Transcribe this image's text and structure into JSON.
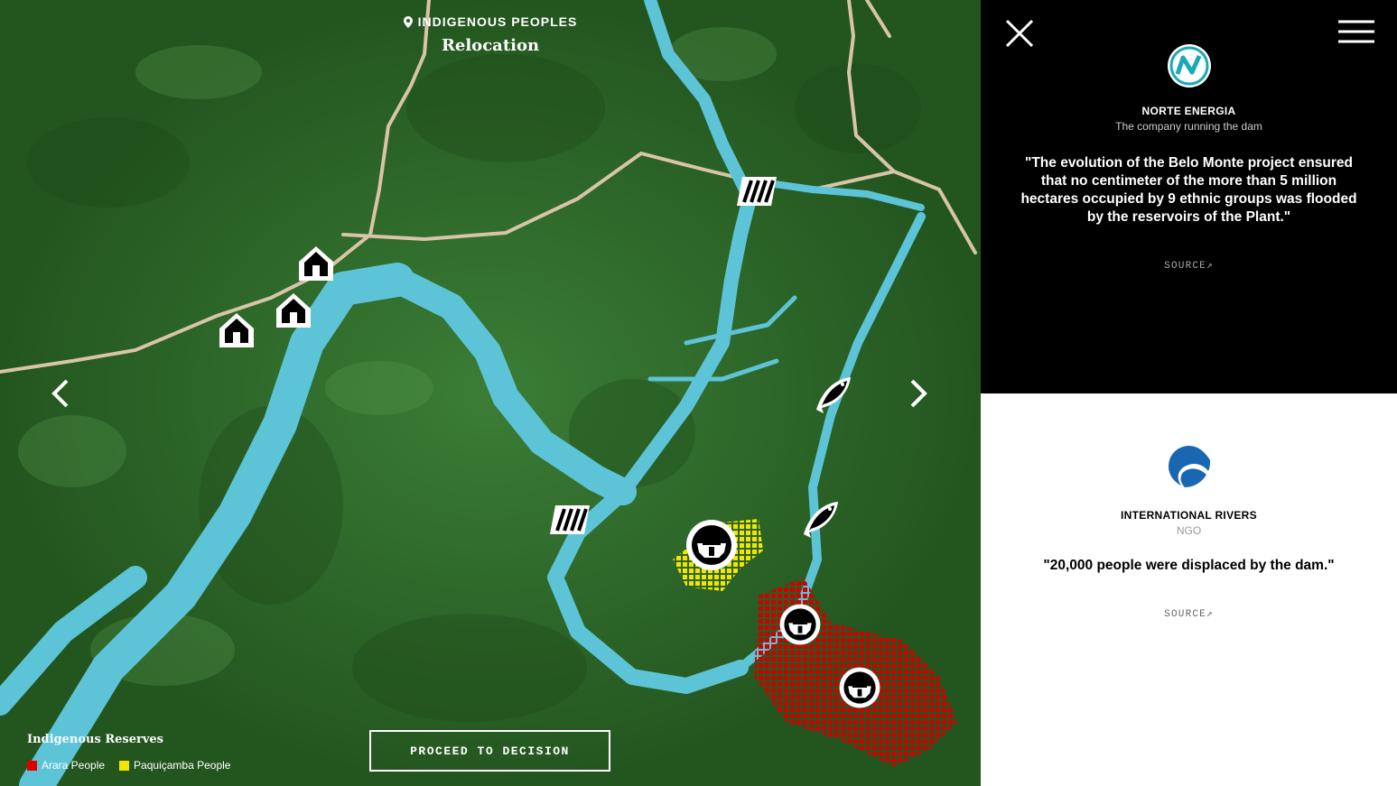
{
  "map": {
    "kicker": "INDIGENOUS PEOPLES",
    "title": "Relocation",
    "legend": {
      "title": "Indigenous Reserves",
      "items": [
        {
          "label": "Arara People",
          "color": "#e00000"
        },
        {
          "label": "Paquiçamba People",
          "color": "#f2e600"
        }
      ]
    },
    "proceed_label": "PROCEED TO DECISION",
    "colors": {
      "forest": "#2d6a2a",
      "river": "#5cc4d6",
      "road": "#d9c4a8"
    }
  },
  "panels": {
    "top": {
      "org_name": "NORTE ENERGIA",
      "org_role": "The company running the dam",
      "quote": "\"The evolution of the Belo Monte project ensured that no centimeter of the more than 5 million hectares occupied by 9 ethnic groups was flooded by the reservoirs of the Plant.\"",
      "source_label": "SOURCE↗",
      "logo_icon": "norte-energia-logo"
    },
    "bottom": {
      "org_name": "INTERNATIONAL RIVERS",
      "org_role": "NGO",
      "quote": "\"20,000 people were displaced by the dam.\"",
      "source_label": "SOURCE↗",
      "logo_icon": "international-rivers-logo"
    }
  }
}
